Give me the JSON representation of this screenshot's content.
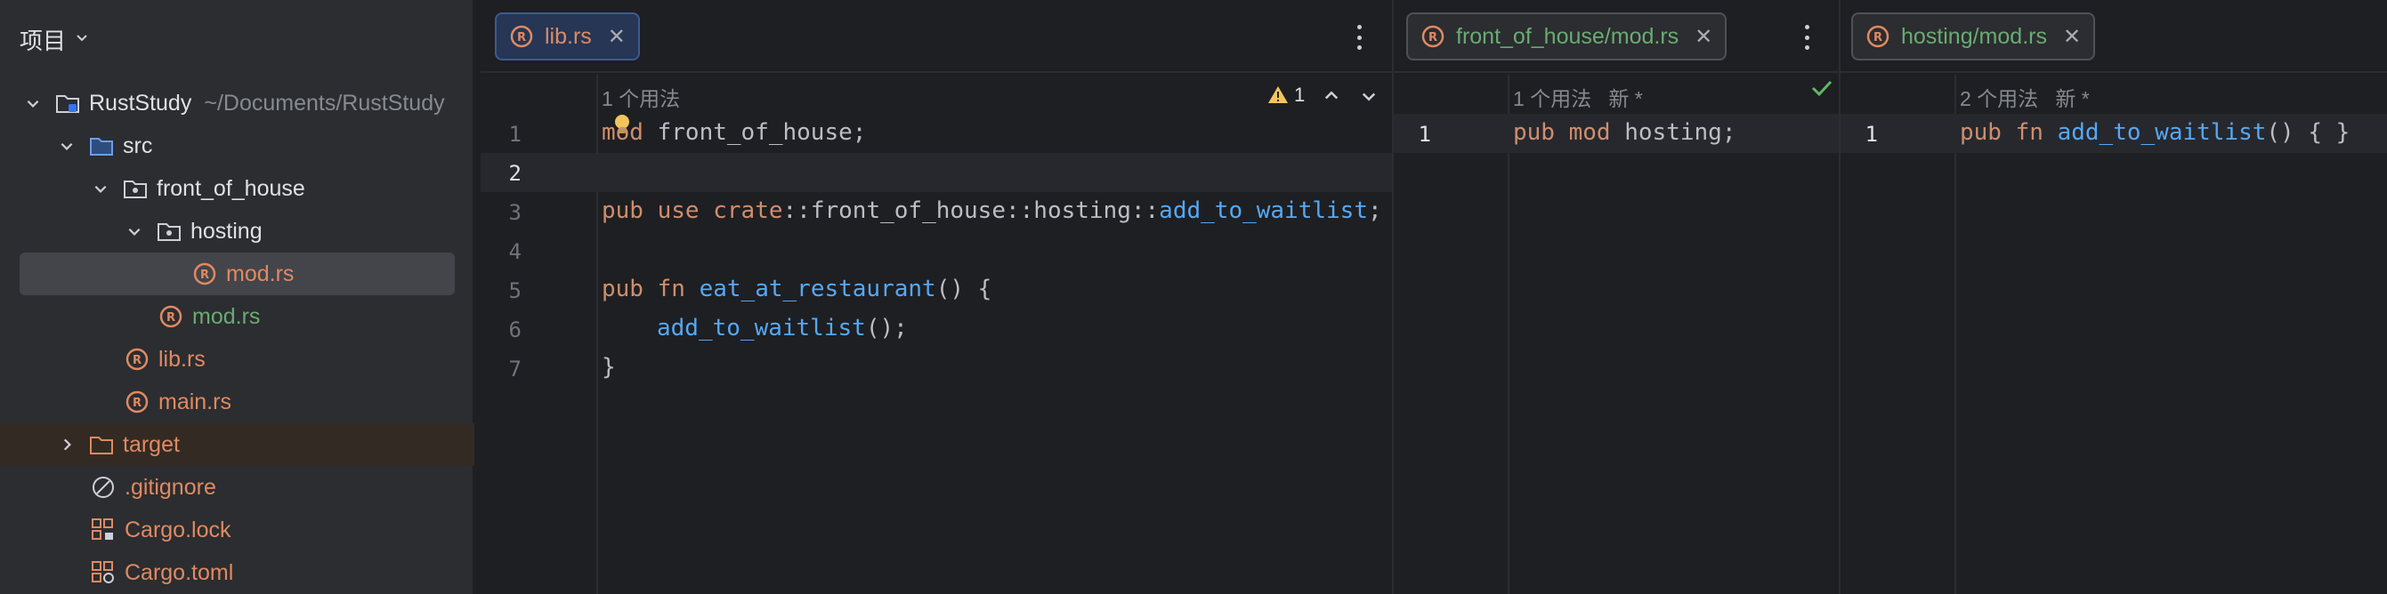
{
  "project": {
    "title": "项目",
    "items": [
      {
        "name": "RustStudy",
        "hint": "~/Documents/RustStudy"
      },
      {
        "name": "src"
      },
      {
        "name": "front_of_house"
      },
      {
        "name": "hosting"
      },
      {
        "name": "mod.rs"
      },
      {
        "name": "mod.rs"
      },
      {
        "name": "lib.rs"
      },
      {
        "name": "main.rs"
      },
      {
        "name": "target"
      },
      {
        "name": ".gitignore"
      },
      {
        "name": "Cargo.lock"
      },
      {
        "name": "Cargo.toml"
      }
    ]
  },
  "editor1": {
    "tab": "lib.rs",
    "usage": "1 个用法",
    "warnings": "1",
    "lines": [
      "1",
      "2",
      "3",
      "4",
      "5",
      "6",
      "7"
    ],
    "code": {
      "l1_kw": "mod",
      "l1_rest": " front_of_house;",
      "l3_a": "pub",
      "l3_b": "use",
      "l3_c": "crate",
      "l3_d": "::front_of_house::hosting::",
      "l3_e": "add_to_waitlist",
      "l3_f": ";",
      "l5_a": "pub",
      "l5_b": "fn",
      "l5_c": "eat_at_restaurant",
      "l5_d": "() {",
      "l6_a": "add_to_waitlist",
      "l6_b": "();",
      "l7": "}"
    }
  },
  "editor2": {
    "tab": "front_of_house/mod.rs",
    "usage": "1 个用法   新 *",
    "lines": [
      "1"
    ],
    "code": {
      "a": "pub",
      "b": "mod",
      "c": " hosting;"
    }
  },
  "editor3": {
    "tab": "hosting/mod.rs",
    "usage": "2 个用法   新 *",
    "lines": [
      "1"
    ],
    "code": {
      "a": "pub",
      "b": "fn",
      "c": "add_to_waitlist",
      "d": "() { }"
    }
  },
  "colors": {
    "accent": "#3d5a8f",
    "keyword": "#cf8e6d",
    "function": "#56a8f5",
    "green": "#6aab73",
    "rust_file": "#e08a62"
  }
}
